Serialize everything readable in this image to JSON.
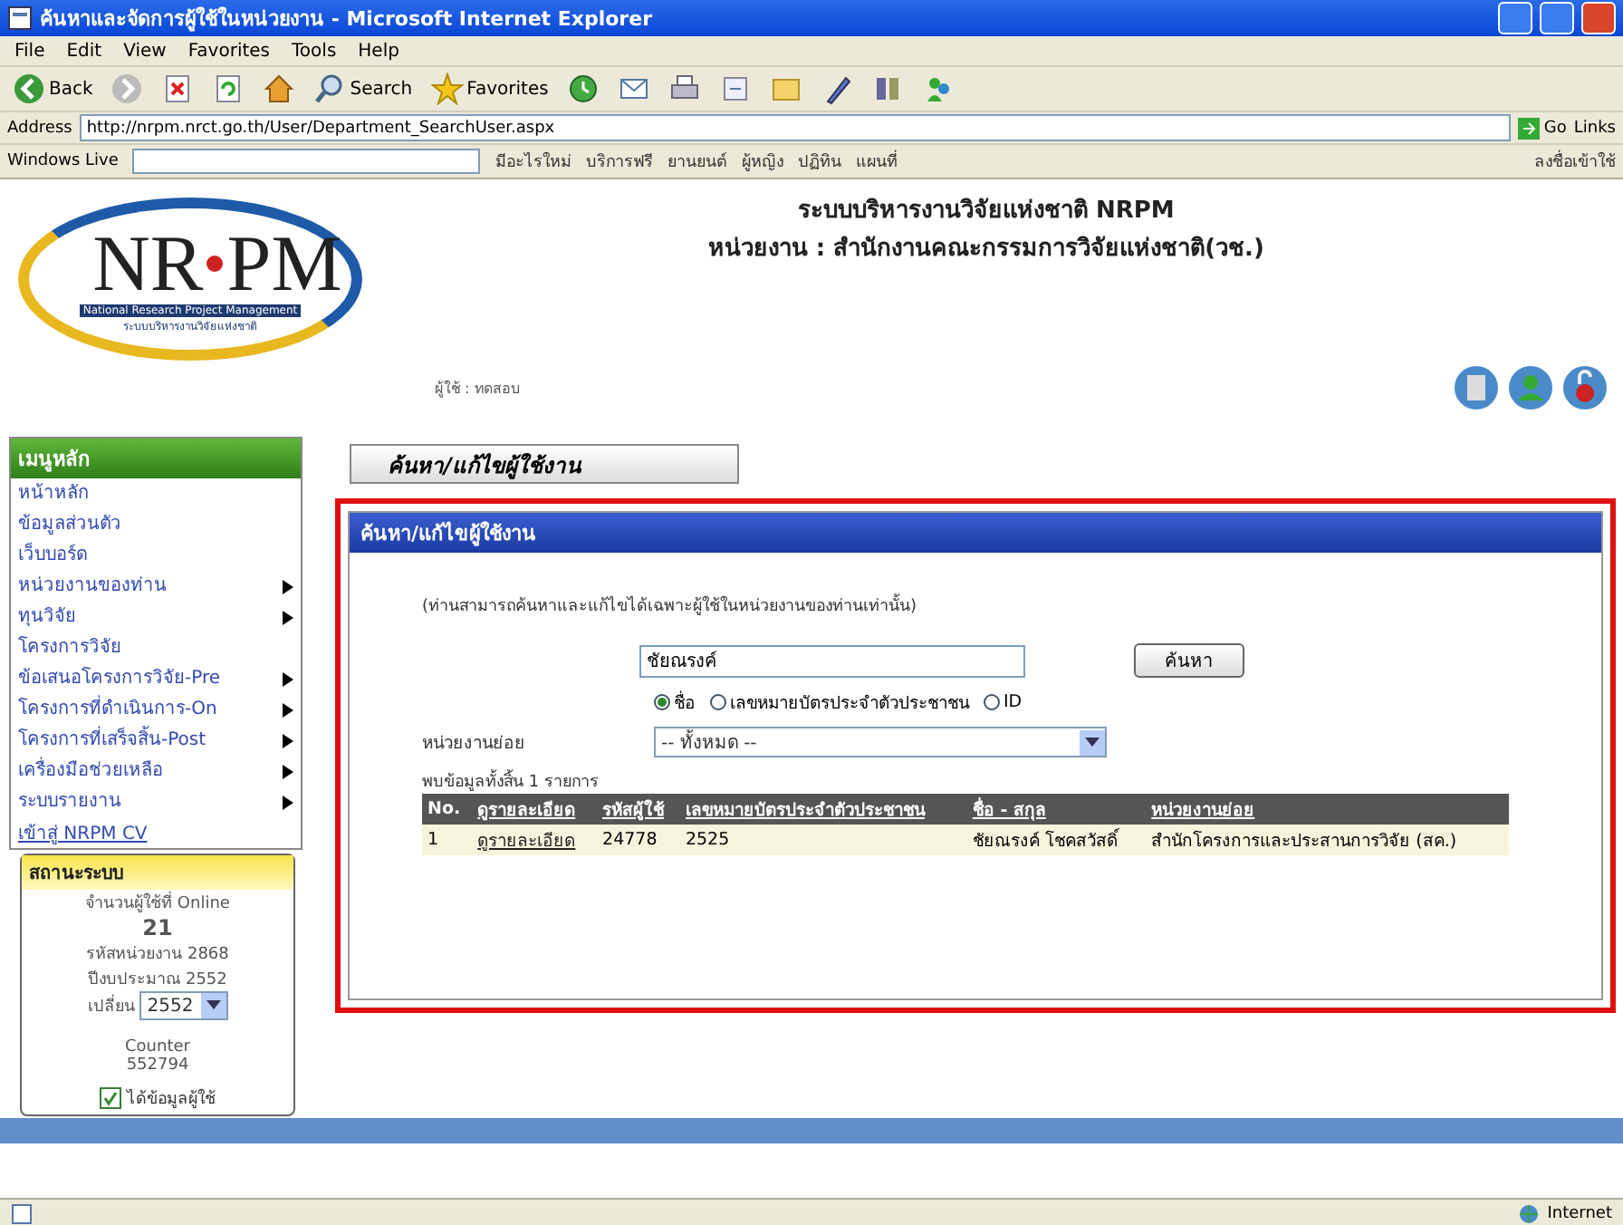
{
  "window": {
    "title": "ค้นหาและจัดการผู้ใช้ในหน่วยงาน - Microsoft Internet Explorer"
  },
  "menu_bar": [
    "File",
    "Edit",
    "View",
    "Favorites",
    "Tools",
    "Help"
  ],
  "toolbar": [
    {
      "kind": "back",
      "label": "Back"
    },
    {
      "kind": "forward"
    },
    {
      "kind": "stop"
    },
    {
      "kind": "refresh"
    },
    {
      "kind": "home"
    },
    {
      "kind": "search",
      "label": "Search"
    },
    {
      "kind": "favorites",
      "label": "Favorites"
    },
    {
      "kind": "history"
    },
    {
      "kind": "mail"
    },
    {
      "kind": "print"
    },
    {
      "kind": "edit"
    },
    {
      "kind": "folder"
    },
    {
      "kind": "pen"
    },
    {
      "kind": "research"
    },
    {
      "kind": "messenger"
    }
  ],
  "address_bar": {
    "label": "Address",
    "url": "http://nrpm.nrct.go.th/User/Department_SearchUser.aspx",
    "go": "Go",
    "links": "Links"
  },
  "live_bar": {
    "brand": "Windows Live",
    "links": [
      "มีอะไรใหม่",
      "บริการฟรี",
      "ยานยนต์",
      "ผู้หญิง",
      "ปฏิทิน",
      "แผนที่"
    ],
    "sign_in": "ลงชื่อเข้าใช้"
  },
  "header": {
    "logo_left": "NR",
    "logo_right": "PM",
    "logo_caption": "National Research Project Management",
    "logo_caption_th": "ระบบบริหารงานวิจัยแห่งชาติ",
    "user": "ผู้ใช้ : ทดสอบ",
    "system_title": "ระบบบริหารงานวิจัยแห่งชาติ NRPM",
    "agency": "หน่วยงาน : สำนักงานคณะกรรมการวิจัยแห่งชาติ(วช.)"
  },
  "sidebar": {
    "title": "เมนูหลัก",
    "items": [
      {
        "label": "หน้าหลัก",
        "has_submenu": false
      },
      {
        "label": "ข้อมูลส่วนตัว",
        "has_submenu": false
      },
      {
        "label": "เว็บบอร์ด",
        "has_submenu": false
      },
      {
        "label": "หน่วยงานของท่าน",
        "has_submenu": true
      },
      {
        "label": "ทุนวิจัย",
        "has_submenu": true
      },
      {
        "label": "โครงการวิจัย",
        "has_submenu": false
      },
      {
        "label": "ข้อเสนอโครงการวิจัย-Pre",
        "has_submenu": true
      },
      {
        "label": "โครงการที่ดำเนินการ-On",
        "has_submenu": true
      },
      {
        "label": "โครงการที่เสร็จสิ้น-Post",
        "has_submenu": true
      },
      {
        "label": "เครื่องมือช่วยเหลือ",
        "has_submenu": true
      },
      {
        "label": "ระบบรายงาน",
        "has_submenu": true
      }
    ],
    "cv_link": "เข้าสู่ NRPM CV"
  },
  "status_box": {
    "title": "สถานะระบบ",
    "online_label": "จำนวนผู้ใช้ที่ Online",
    "online_count": "21",
    "agency_code": "รหัสหน่วยงาน 2868",
    "fiscal_year": "ปีงบประมาณ 2552",
    "year_label": "เปลี่ยน",
    "year_value": "2552",
    "counter_label": "Counter",
    "counter_value": "552794",
    "remember": {
      "label": "ได้ข้อมูลผู้ใช้",
      "checked": true
    }
  },
  "tab_button": "ค้นหา/แก้ไขผู้ใช้งาน",
  "panel": {
    "title": "ค้นหา/แก้ไขผู้ใช้งาน",
    "note": "(ท่านสามารถค้นหาและแก้ไขได้เฉพาะผู้ใช้ในหน่วยงานของท่านเท่านั้น)",
    "search": {
      "value": "ชัยณรงค์",
      "button": "ค้นหา"
    },
    "radios": [
      {
        "label": "ชื่อ",
        "selected": true
      },
      {
        "label": "เลขหมายบัตรประจำตัวประชาชน",
        "selected": false
      },
      {
        "label": "ID",
        "selected": false
      }
    ],
    "unit_label": "หน่วยงานย่อย",
    "unit_select": "-- ทั้งหมด --",
    "result_count": "พบข้อมูลทั้งสิ้น 1 รายการ",
    "table": {
      "columns": [
        "No.",
        "ดูรายละเอียด",
        "รหัสผู้ใช้",
        "เลขหมายบัตรประจำตัวประชาชน",
        "ชื่อ - สกุล",
        "หน่วยงานย่อย"
      ],
      "rows": [
        [
          "1",
          "ดูรายละเอียด",
          "24778",
          "2525",
          "ชัยณรงค์ โชคสวัสดิ์",
          "สำนักโครงการและประสานการวิจัย (สค.)"
        ]
      ]
    }
  },
  "status_bar": {
    "zone": "Internet"
  }
}
